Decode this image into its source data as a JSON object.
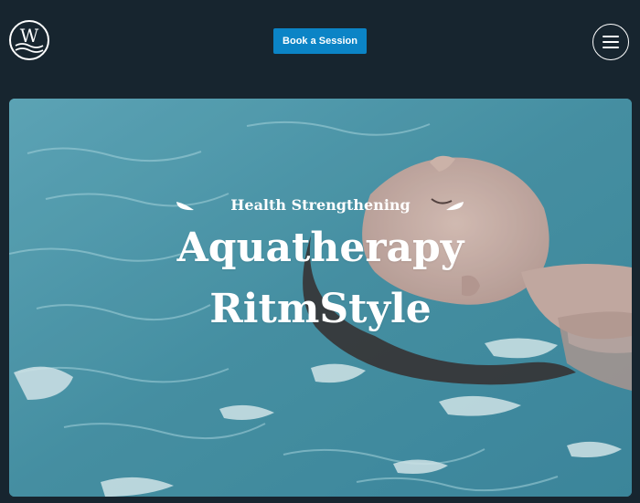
{
  "header": {
    "logo_letter": "W",
    "book_button_label": "Book a Session"
  },
  "hero": {
    "eyebrow": "Health Strengthening",
    "title_line1": "Aquatherapy",
    "title_line2": "RitmStyle"
  },
  "colors": {
    "page_background": "#17252f",
    "button_accent": "#0b84c6",
    "water": "#4f99ab",
    "text": "#ffffff"
  },
  "icons": [
    "logo-icon",
    "hamburger-menu-icon",
    "leaf-ornament-icon"
  ]
}
